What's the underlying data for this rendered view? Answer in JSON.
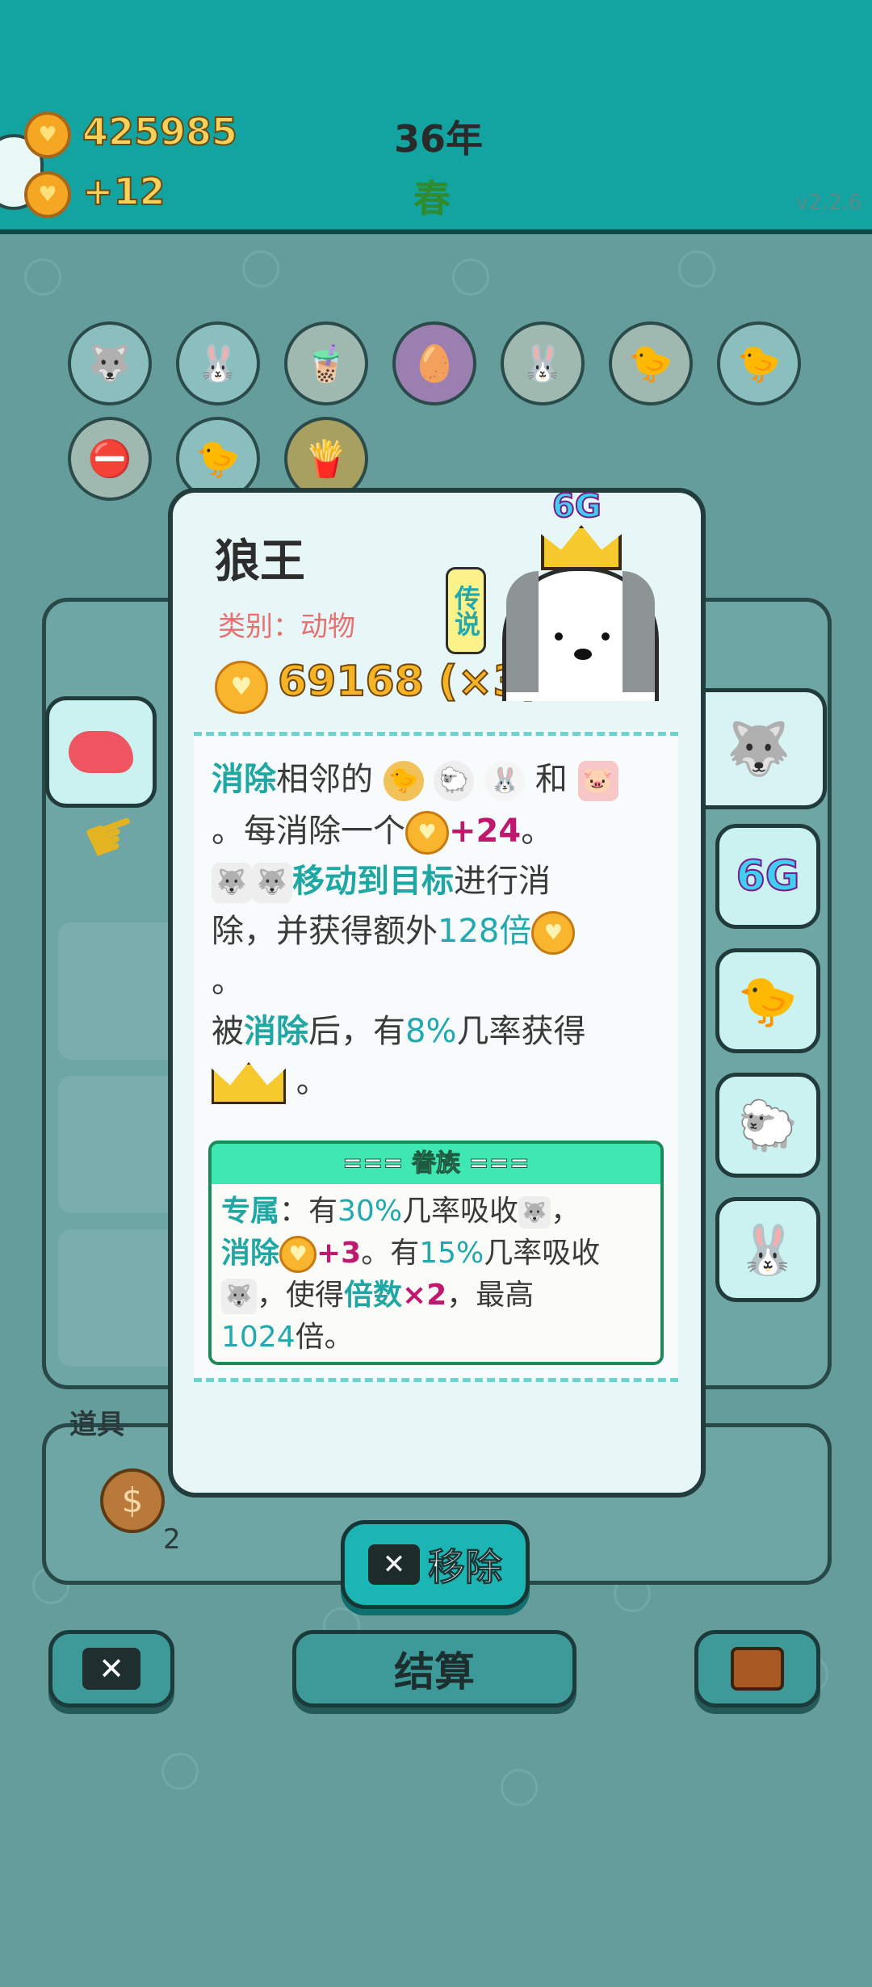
{
  "top": {
    "coins": "425985",
    "income": "+12",
    "year": "36年",
    "season": "春",
    "version": "v2.2.6"
  },
  "background": {
    "props_label": "道具",
    "coin_item_count": "2",
    "settle_button": "结算"
  },
  "card": {
    "name": "狼王",
    "category": "类别：动物",
    "rarity": "传说",
    "badge": "6G",
    "value": "69168 (×3)",
    "desc": {
      "l1_kw": "消除",
      "l1_text": "相邻的",
      "l1_and": "和",
      "l2_text": "。每消除一个",
      "l2_bonus": "+24",
      "l2_end": "。",
      "l3_kw": "移动到目标",
      "l3_text": "进行消",
      "l4_text": "除，并获得额外",
      "l4_num": "128倍",
      "l5_text": "。",
      "l6_a": "被",
      "l6_kw": "消除",
      "l6_b": "后，有",
      "l6_pct": "8%",
      "l6_c": "几率获得",
      "l7_text": "。"
    },
    "faction": {
      "title": "=== 眷族 ===",
      "r1_kw": "专属",
      "r1_a": "：有",
      "r1_pct": "30%",
      "r1_b": "几率吸收",
      "r1_end": "，",
      "r2_kw": "消除",
      "r2_bonus": "+3",
      "r2_a": "。有",
      "r2_pct": "15%",
      "r2_b": "几率吸收",
      "r3_a": "，使得",
      "r3_kw": "倍数",
      "r3_mult": "×2",
      "r3_b": "，最高",
      "r4_num": "1024",
      "r4_a": "倍。"
    },
    "remove_button": "移除"
  },
  "side": {
    "badge": "6G"
  },
  "colors": {
    "teal": "#13a3a0",
    "keyword": "#1fa7a4",
    "magenta": "#c0186f",
    "gold": "#f8b52d"
  },
  "icons": [
    "heart-coin-icon",
    "husky-icon",
    "rabbit-icon",
    "coffee-cup-icon",
    "egg-icon",
    "chick-icon",
    "no-entry-icon",
    "fries-icon",
    "liver-icon",
    "crown-icon",
    "sheep-icon",
    "pig-icon",
    "close-icon",
    "briefcase-icon",
    "dollar-coin-icon",
    "pointer-hand-icon"
  ]
}
